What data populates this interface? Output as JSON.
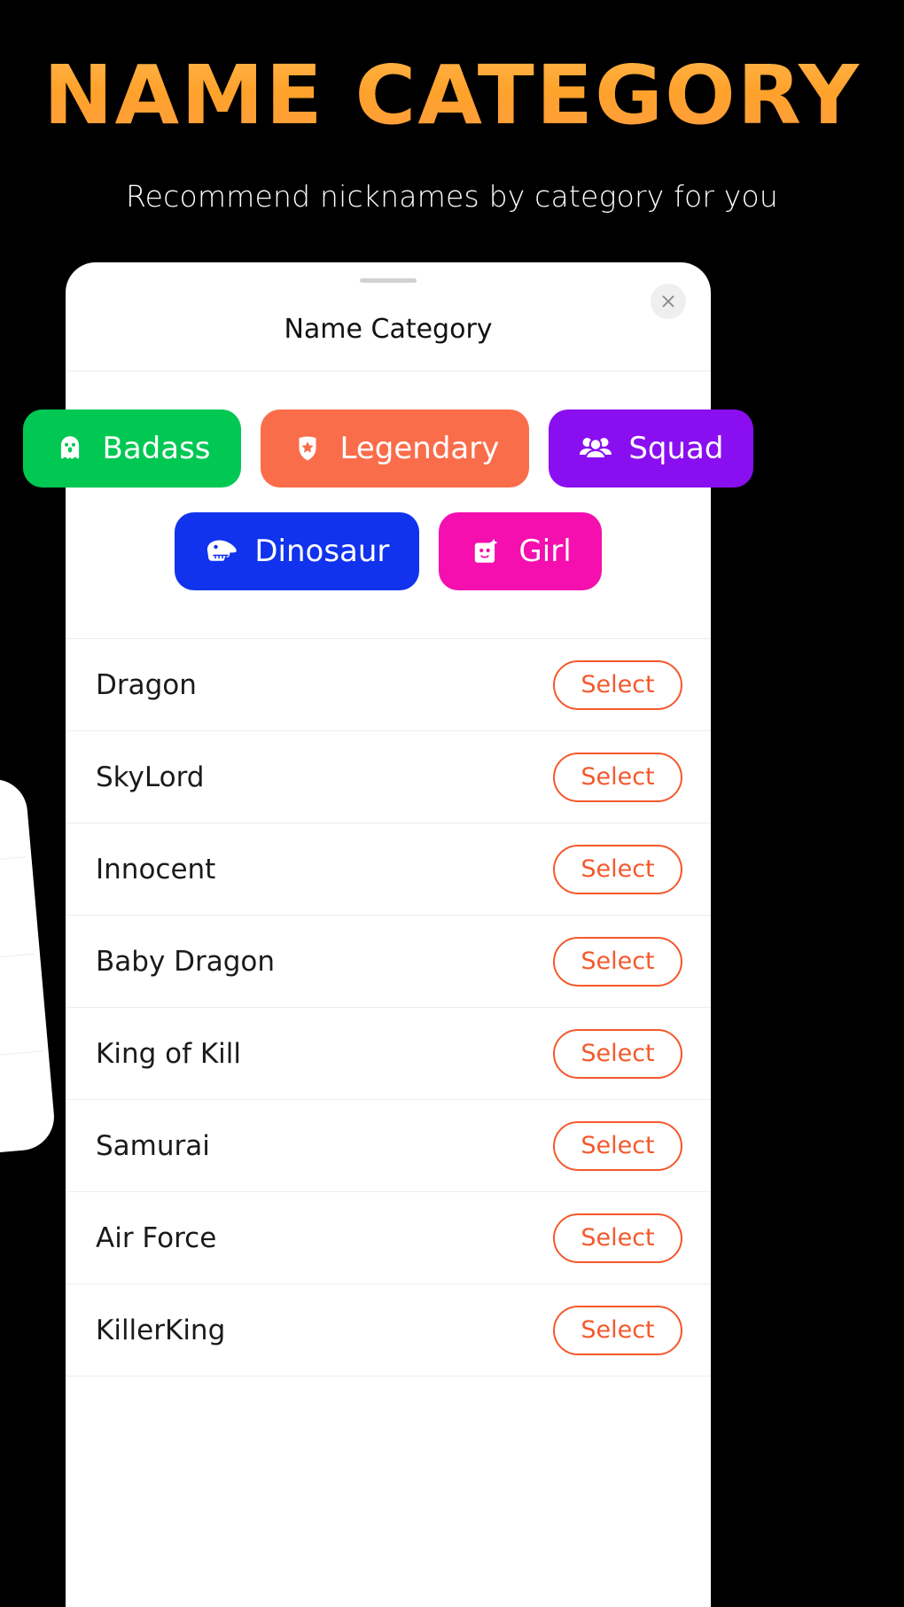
{
  "hero": {
    "title": "NAME CATEGORY",
    "subtitle": "Recommend nicknames by category for you",
    "title_gradient_from": "#FFB347",
    "title_gradient_to": "#FF9D3D"
  },
  "sheet": {
    "title": "Name Category",
    "close_icon": "close-icon",
    "grabber": "drag-handle"
  },
  "categories": [
    {
      "label": "Badass",
      "icon": "ghost-icon",
      "color": "#00C853"
    },
    {
      "label": "Legendary",
      "icon": "shield-star-icon",
      "color": "#FA6D4B"
    },
    {
      "label": "Squad",
      "icon": "people-group-icon",
      "color": "#8A0FF0"
    },
    {
      "label": "Dinosaur",
      "icon": "dinosaur-skull-icon",
      "color": "#1133EE"
    },
    {
      "label": "Girl",
      "icon": "girl-avatar-icon",
      "color": "#F50FAF"
    }
  ],
  "list": {
    "select_label": "Select",
    "select_color": "#F4592C",
    "items": [
      {
        "name": "Dragon"
      },
      {
        "name": "SkyLord"
      },
      {
        "name": "Innocent"
      },
      {
        "name": "Baby Dragon"
      },
      {
        "name": "King of Kill"
      },
      {
        "name": "Samurai"
      },
      {
        "name": "Air Force"
      },
      {
        "name": "KillerKing"
      }
    ]
  }
}
